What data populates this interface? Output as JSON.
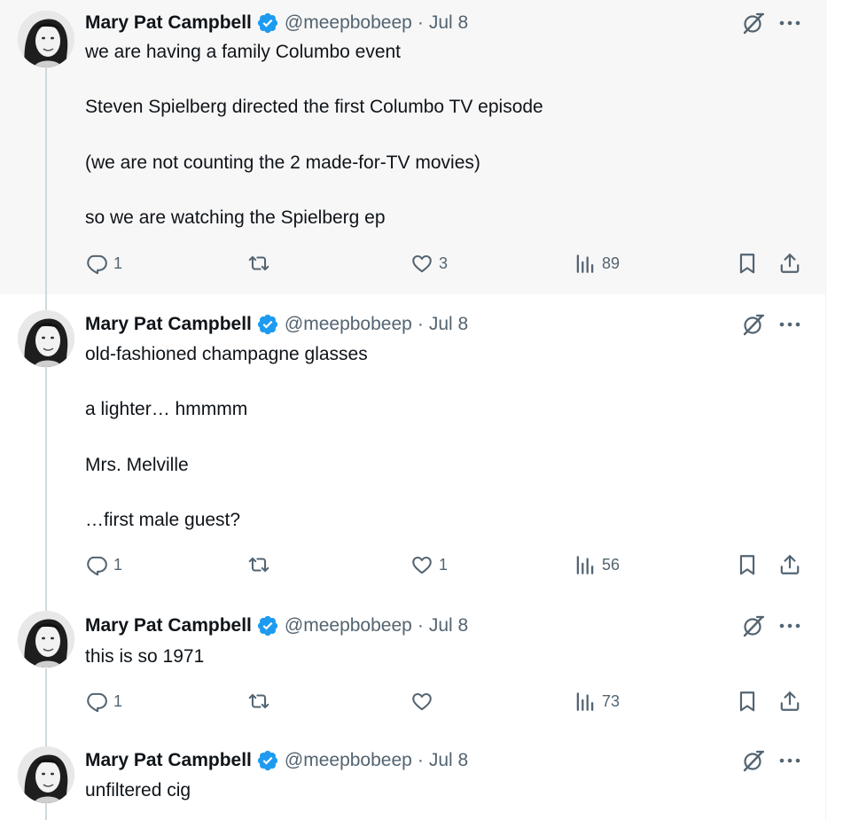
{
  "author": {
    "name": "Mary Pat Campbell",
    "handle": "@meepbobeep",
    "separator": "·",
    "verified": true
  },
  "icons": {
    "verified": "verified-badge-icon",
    "grok": "grok-icon",
    "more": "more-options-icon",
    "reply": "reply-icon",
    "retweet": "retweet-icon",
    "like": "like-icon",
    "views": "views-icon",
    "bookmark": "bookmark-icon",
    "share": "share-icon"
  },
  "colors": {
    "verified_blue": "#1d9bf0",
    "secondary_text": "#536471",
    "highlight_background": "#f7f7f7",
    "thread_line": "#cfd9de"
  },
  "tweets": [
    {
      "date": "Jul 8",
      "highlighted": true,
      "lines": [
        "we are having a family Columbo event",
        "Steven Spielberg directed the first Columbo TV episode",
        "(we are not counting the 2 made-for-TV movies)",
        "so we are watching the Spielberg ep"
      ],
      "replies": "1",
      "retweets": "",
      "likes": "3",
      "views": "89"
    },
    {
      "date": "Jul 8",
      "highlighted": false,
      "lines": [
        "old-fashioned champagne glasses",
        "a lighter… hmmmm",
        "Mrs. Melville",
        "…first male guest?"
      ],
      "replies": "1",
      "retweets": "",
      "likes": "1",
      "views": "56"
    },
    {
      "date": "Jul 8",
      "highlighted": false,
      "lines": [
        "this is so 1971"
      ],
      "replies": "1",
      "retweets": "",
      "likes": "",
      "views": "73"
    },
    {
      "date": "Jul 8",
      "highlighted": false,
      "lines": [
        "unfiltered cig"
      ],
      "replies": "",
      "retweets": "",
      "likes": "",
      "views": ""
    }
  ]
}
